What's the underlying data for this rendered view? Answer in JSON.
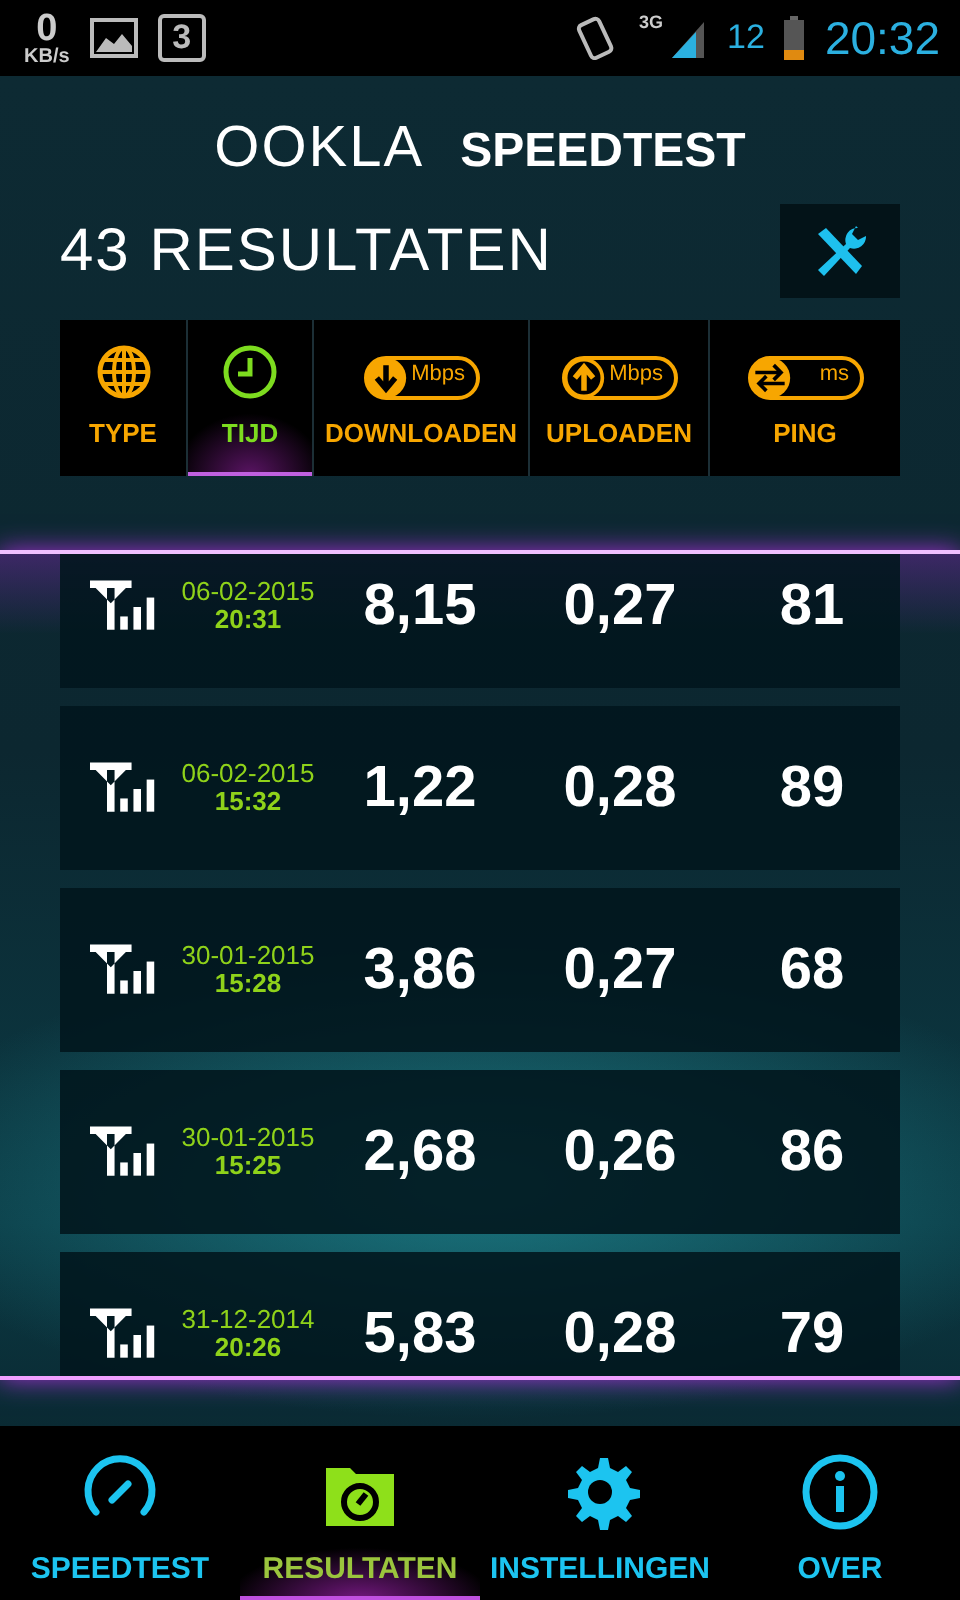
{
  "status_bar": {
    "net_speed": "0",
    "net_unit": "KB/s",
    "notification_count": "3",
    "network": "3G",
    "battery": "12",
    "time": "20:32"
  },
  "logo": {
    "brand": "OOKLA",
    "product": "SPEEDTEST"
  },
  "title": "43 RESULTATEN",
  "sort_columns": [
    {
      "kind": "type",
      "label": "TYPE",
      "selected": false
    },
    {
      "kind": "time",
      "label": "TIJD",
      "selected": true
    },
    {
      "kind": "download",
      "label": "DOWNLOADEN",
      "unit": "Mbps",
      "selected": false
    },
    {
      "kind": "upload",
      "label": "UPLOADEN",
      "unit": "Mbps",
      "selected": false
    },
    {
      "kind": "ping",
      "label": "PING",
      "unit": "ms",
      "selected": false
    }
  ],
  "results": [
    {
      "date": "06-02-2015",
      "time": "20:31",
      "download": "8,15",
      "upload": "0,27",
      "ping": "81"
    },
    {
      "date": "06-02-2015",
      "time": "15:32",
      "download": "1,22",
      "upload": "0,28",
      "ping": "89"
    },
    {
      "date": "30-01-2015",
      "time": "15:28",
      "download": "3,86",
      "upload": "0,27",
      "ping": "68"
    },
    {
      "date": "30-01-2015",
      "time": "15:25",
      "download": "2,68",
      "upload": "0,26",
      "ping": "86"
    },
    {
      "date": "31-12-2014",
      "time": "20:26",
      "download": "5,83",
      "upload": "0,28",
      "ping": "79"
    }
  ],
  "nav": [
    {
      "kind": "speedtest",
      "label": "SPEEDTEST",
      "selected": false
    },
    {
      "kind": "results",
      "label": "RESULTATEN",
      "selected": true
    },
    {
      "kind": "settings",
      "label": "INSTELLINGEN",
      "selected": false
    },
    {
      "kind": "about",
      "label": "OVER",
      "selected": false
    }
  ]
}
